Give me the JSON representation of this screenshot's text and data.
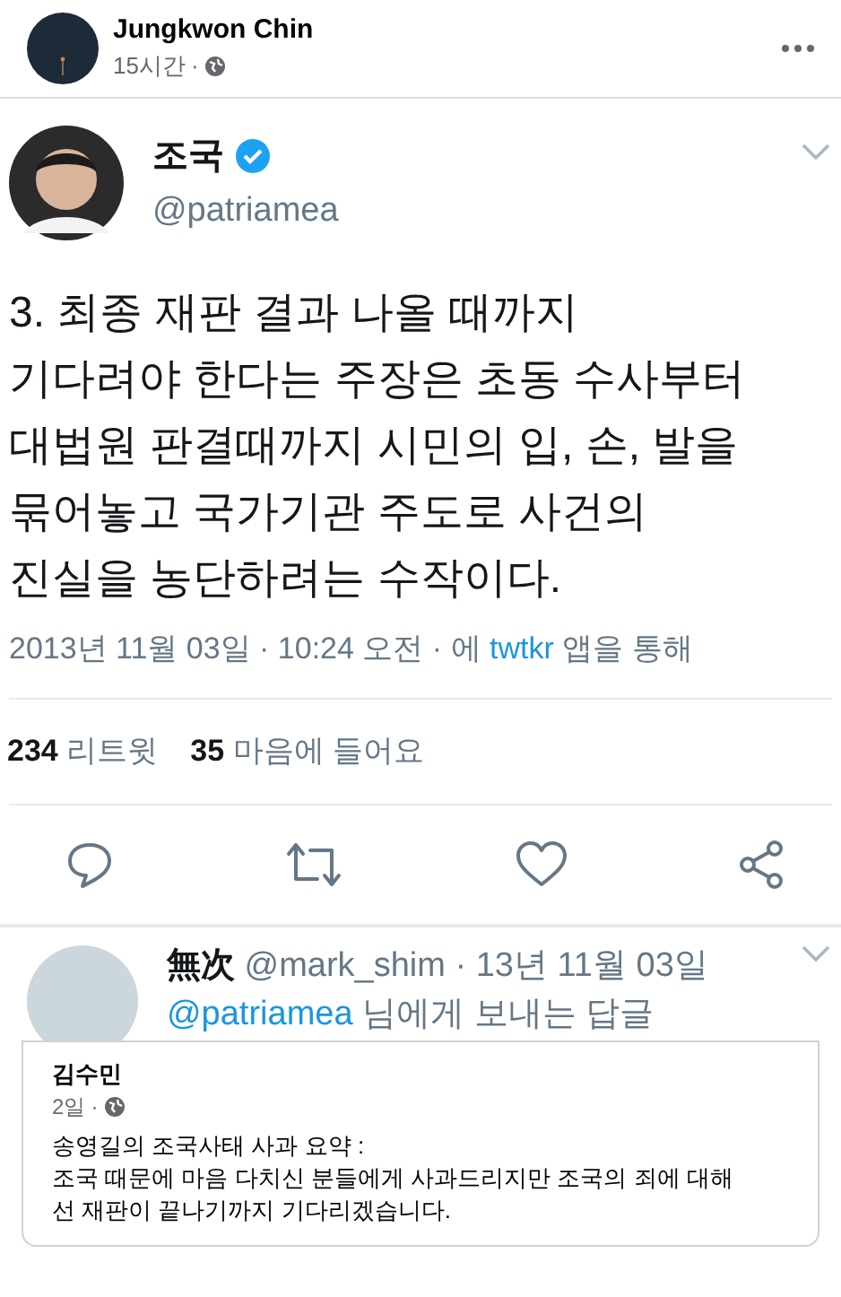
{
  "post": {
    "author": "Jungkwon Chin",
    "time": "15시간",
    "separator": "·"
  },
  "tweet": {
    "name": "조국",
    "verified": true,
    "handle": "@patriamea",
    "text_lines": [
      "3. 최종 재판 결과 나올 때까지",
      "기다려야 한다는 주장은 초동 수사부터",
      "대법원 판결때까지 시민의 입, 손, 발을",
      "묶어놓고 국가기관 주도로 사건의",
      "진실을 농단하려는 수작이다."
    ],
    "date": "2013년 11월 03일 · 10:24 오전 · 에",
    "client": "twtkr",
    "via": "앱을 통해",
    "stats": [
      {
        "count": "234",
        "label": "리트윗"
      },
      {
        "count": "35",
        "label": "마음에 들어요"
      }
    ],
    "actions": [
      {
        "kind": "reply"
      },
      {
        "kind": "retweet"
      },
      {
        "kind": "like"
      },
      {
        "kind": "share"
      }
    ],
    "reply": {
      "name": "無次",
      "handle": "@mark_shim · 13년 11월 03일",
      "mention": "@patriamea",
      "reply_label": "님에게 보내는 답글"
    }
  },
  "shared_post": {
    "author": "김수민",
    "time": "2일",
    "separator": "·",
    "text_lines": [
      "송영길의 조국사태 사과 요약 :",
      "조국 때문에 마음 다치신 분들에게 사과드리지만 조국의 죄에 대해",
      "선 재판이 끝나기까지 기다리겠습니다."
    ]
  }
}
